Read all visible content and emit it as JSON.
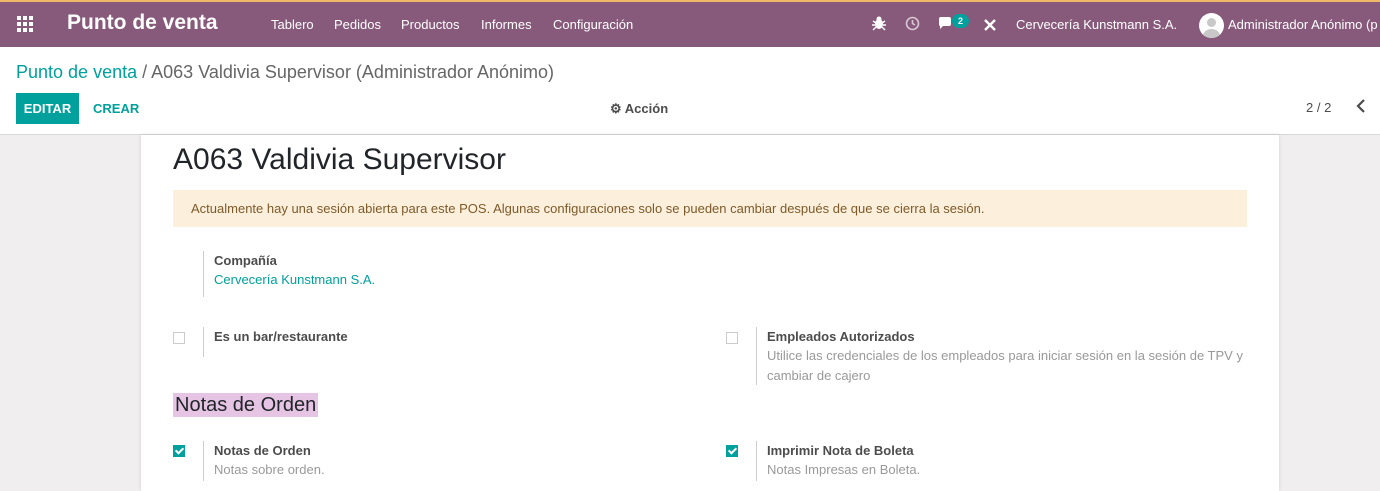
{
  "navbar": {
    "app_title": "Punto de venta",
    "menu": [
      "Tablero",
      "Pedidos",
      "Productos",
      "Informes",
      "Configuración"
    ],
    "messages_count": "2",
    "company": "Cervecería Kunstmann S.A.",
    "user": "Administrador Anónimo (p"
  },
  "control_panel": {
    "breadcrumb_root": "Punto de venta",
    "breadcrumb_separator": "/",
    "breadcrumb_current": "A063 Valdivia Supervisor (Administrador Anónimo)",
    "edit_label": "EDITAR",
    "create_label": "CREAR",
    "action_label": "Acción",
    "pager": "2 / 2"
  },
  "form": {
    "title": "A063 Valdivia Supervisor",
    "alert": "Actualmente hay una sesión abierta para este POS. Algunas configuraciones solo se pueden cambiar después de que se cierra la sesión.",
    "company_label": "Compañía",
    "company_value": "Cervecería Kunstmann S.A.",
    "bar_label": "Es un bar/restaurante",
    "bar_checked": false,
    "employees_label": "Empleados Autorizados",
    "employees_help": "Utilice las credenciales de los empleados para iniciar sesión en la sesión de TPV y cambiar de cajero",
    "employees_checked": false,
    "section_title": "Notas de Orden",
    "notes_label": "Notas de Orden",
    "notes_help": "Notas sobre orden.",
    "notes_checked": true,
    "receipt_label": "Imprimir Nota de Boleta",
    "receipt_help": "Notas Impresas en Boleta.",
    "receipt_checked": true
  },
  "icons": [
    "apps-icon",
    "bug-icon",
    "clock-icon",
    "chat-icon",
    "close-tools-icon",
    "gear-icon",
    "chevron-left-icon"
  ],
  "colors": {
    "navbar": "#875a7b",
    "accent": "#00a09d",
    "alert_bg": "#fcefdc",
    "section_highlight": "#e6c4e4"
  }
}
